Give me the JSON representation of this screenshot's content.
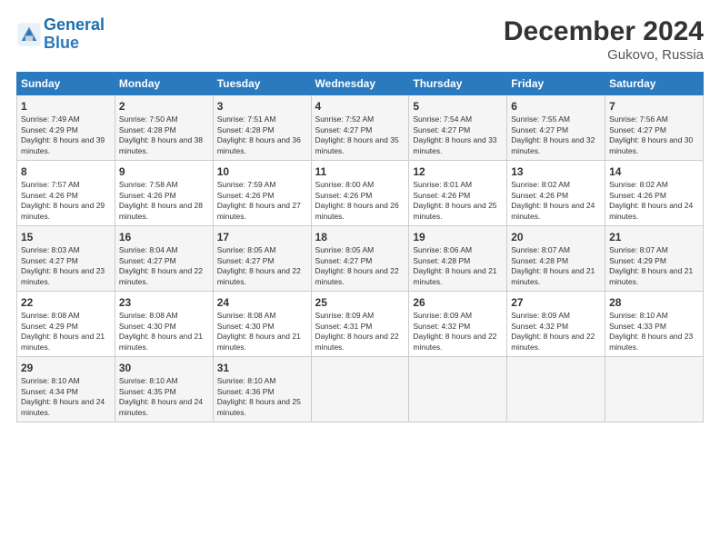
{
  "header": {
    "logo_line1": "General",
    "logo_line2": "Blue",
    "title": "December 2024",
    "subtitle": "Gukovo, Russia"
  },
  "days_of_week": [
    "Sunday",
    "Monday",
    "Tuesday",
    "Wednesday",
    "Thursday",
    "Friday",
    "Saturday"
  ],
  "weeks": [
    [
      {
        "day": "1",
        "info": "Sunrise: 7:49 AM\nSunset: 4:29 PM\nDaylight: 8 hours and 39 minutes."
      },
      {
        "day": "2",
        "info": "Sunrise: 7:50 AM\nSunset: 4:28 PM\nDaylight: 8 hours and 38 minutes."
      },
      {
        "day": "3",
        "info": "Sunrise: 7:51 AM\nSunset: 4:28 PM\nDaylight: 8 hours and 36 minutes."
      },
      {
        "day": "4",
        "info": "Sunrise: 7:52 AM\nSunset: 4:27 PM\nDaylight: 8 hours and 35 minutes."
      },
      {
        "day": "5",
        "info": "Sunrise: 7:54 AM\nSunset: 4:27 PM\nDaylight: 8 hours and 33 minutes."
      },
      {
        "day": "6",
        "info": "Sunrise: 7:55 AM\nSunset: 4:27 PM\nDaylight: 8 hours and 32 minutes."
      },
      {
        "day": "7",
        "info": "Sunrise: 7:56 AM\nSunset: 4:27 PM\nDaylight: 8 hours and 30 minutes."
      }
    ],
    [
      {
        "day": "8",
        "info": "Sunrise: 7:57 AM\nSunset: 4:26 PM\nDaylight: 8 hours and 29 minutes."
      },
      {
        "day": "9",
        "info": "Sunrise: 7:58 AM\nSunset: 4:26 PM\nDaylight: 8 hours and 28 minutes."
      },
      {
        "day": "10",
        "info": "Sunrise: 7:59 AM\nSunset: 4:26 PM\nDaylight: 8 hours and 27 minutes."
      },
      {
        "day": "11",
        "info": "Sunrise: 8:00 AM\nSunset: 4:26 PM\nDaylight: 8 hours and 26 minutes."
      },
      {
        "day": "12",
        "info": "Sunrise: 8:01 AM\nSunset: 4:26 PM\nDaylight: 8 hours and 25 minutes."
      },
      {
        "day": "13",
        "info": "Sunrise: 8:02 AM\nSunset: 4:26 PM\nDaylight: 8 hours and 24 minutes."
      },
      {
        "day": "14",
        "info": "Sunrise: 8:02 AM\nSunset: 4:26 PM\nDaylight: 8 hours and 24 minutes."
      }
    ],
    [
      {
        "day": "15",
        "info": "Sunrise: 8:03 AM\nSunset: 4:27 PM\nDaylight: 8 hours and 23 minutes."
      },
      {
        "day": "16",
        "info": "Sunrise: 8:04 AM\nSunset: 4:27 PM\nDaylight: 8 hours and 22 minutes."
      },
      {
        "day": "17",
        "info": "Sunrise: 8:05 AM\nSunset: 4:27 PM\nDaylight: 8 hours and 22 minutes."
      },
      {
        "day": "18",
        "info": "Sunrise: 8:05 AM\nSunset: 4:27 PM\nDaylight: 8 hours and 22 minutes."
      },
      {
        "day": "19",
        "info": "Sunrise: 8:06 AM\nSunset: 4:28 PM\nDaylight: 8 hours and 21 minutes."
      },
      {
        "day": "20",
        "info": "Sunrise: 8:07 AM\nSunset: 4:28 PM\nDaylight: 8 hours and 21 minutes."
      },
      {
        "day": "21",
        "info": "Sunrise: 8:07 AM\nSunset: 4:29 PM\nDaylight: 8 hours and 21 minutes."
      }
    ],
    [
      {
        "day": "22",
        "info": "Sunrise: 8:08 AM\nSunset: 4:29 PM\nDaylight: 8 hours and 21 minutes."
      },
      {
        "day": "23",
        "info": "Sunrise: 8:08 AM\nSunset: 4:30 PM\nDaylight: 8 hours and 21 minutes."
      },
      {
        "day": "24",
        "info": "Sunrise: 8:08 AM\nSunset: 4:30 PM\nDaylight: 8 hours and 21 minutes."
      },
      {
        "day": "25",
        "info": "Sunrise: 8:09 AM\nSunset: 4:31 PM\nDaylight: 8 hours and 22 minutes."
      },
      {
        "day": "26",
        "info": "Sunrise: 8:09 AM\nSunset: 4:32 PM\nDaylight: 8 hours and 22 minutes."
      },
      {
        "day": "27",
        "info": "Sunrise: 8:09 AM\nSunset: 4:32 PM\nDaylight: 8 hours and 22 minutes."
      },
      {
        "day": "28",
        "info": "Sunrise: 8:10 AM\nSunset: 4:33 PM\nDaylight: 8 hours and 23 minutes."
      }
    ],
    [
      {
        "day": "29",
        "info": "Sunrise: 8:10 AM\nSunset: 4:34 PM\nDaylight: 8 hours and 24 minutes."
      },
      {
        "day": "30",
        "info": "Sunrise: 8:10 AM\nSunset: 4:35 PM\nDaylight: 8 hours and 24 minutes."
      },
      {
        "day": "31",
        "info": "Sunrise: 8:10 AM\nSunset: 4:36 PM\nDaylight: 8 hours and 25 minutes."
      },
      {
        "day": "",
        "info": ""
      },
      {
        "day": "",
        "info": ""
      },
      {
        "day": "",
        "info": ""
      },
      {
        "day": "",
        "info": ""
      }
    ]
  ]
}
